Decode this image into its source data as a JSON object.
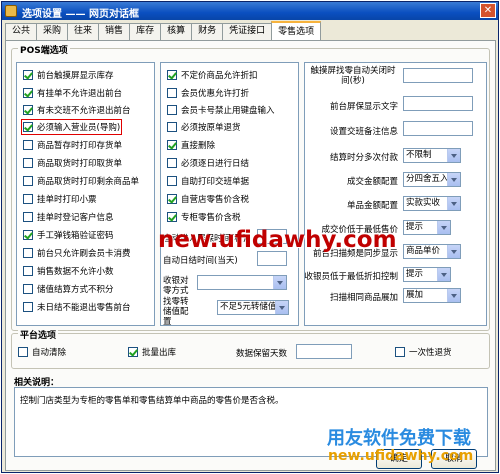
{
  "window": {
    "title": "选项设置 —— 网页对话框",
    "close_glyph": "✕"
  },
  "tabs": [
    "公共",
    "采购",
    "往来",
    "销售",
    "库存",
    "核算",
    "财务",
    "凭证接口",
    "零售选项"
  ],
  "pos_group": {
    "legend": "POS端选项",
    "left_items": [
      {
        "label": "前台触摸屏显示库存",
        "checked": true
      },
      {
        "label": "有挂单不允许退出前台",
        "checked": true
      },
      {
        "label": "有未交班不允许退出前台",
        "checked": true
      },
      {
        "label": "必须输入营业员(导购)",
        "checked": true
      },
      {
        "label": "商品暂存时打印存货单",
        "checked": false
      },
      {
        "label": "商品取货时打印取货单",
        "checked": false
      },
      {
        "label": "商品取货时打印剩余商品单",
        "checked": false
      },
      {
        "label": "挂单时打印小票",
        "checked": false
      },
      {
        "label": "挂单时登记客户信息",
        "checked": false
      },
      {
        "label": "手工弹钱箱验证密码",
        "checked": true
      },
      {
        "label": "前台只允许刷会员卡消费",
        "checked": false
      },
      {
        "label": "销售数据不允许小数",
        "checked": false
      },
      {
        "label": "储值结算方式不积分",
        "checked": false
      },
      {
        "label": "未日结不能退出零售前台",
        "checked": false
      }
    ],
    "mid_items": [
      {
        "label": "不定价商品允许折扣",
        "checked": true
      },
      {
        "label": "会员优惠允许打折",
        "checked": false
      },
      {
        "label": "会员卡号禁止用键盘输入",
        "checked": false
      },
      {
        "label": "必须按原单退货",
        "checked": false
      },
      {
        "label": "直接删除",
        "checked": true
      },
      {
        "label": "必须逐日进行日结",
        "checked": false
      },
      {
        "label": "自助打印交班单据",
        "checked": false
      },
      {
        "label": "自营店零售价含税",
        "checked": true
      },
      {
        "label": "专柜零售价含税",
        "checked": true
      }
    ],
    "mid_fields": {
      "screensaver_label": "自动进入屏保时间(秒)",
      "auto_daily_label": "自动日结时间(当天)",
      "rounding_label": "收银对零方式",
      "change_label": "找零转储值配置",
      "change_value": "不足5元转储值"
    },
    "right_fields": [
      {
        "label": "触摸屏找零自动关闭时间(秒)",
        "kind": "input",
        "value": ""
      },
      {
        "label": "前台屏保显示文字",
        "kind": "input",
        "value": ""
      },
      {
        "label": "设置交班备注信息",
        "kind": "input",
        "value": ""
      },
      {
        "label": "结算时分多次付款",
        "kind": "combo",
        "value": "不限制"
      },
      {
        "label": "成交金额配置",
        "kind": "combo",
        "value": "分四舍五入"
      },
      {
        "label": "单品金额配置",
        "kind": "combo",
        "value": "实款实收"
      },
      {
        "label": "成交价低于最低售价",
        "kind": "combo",
        "value": "提示"
      },
      {
        "label": "前台扫描频是同步显示",
        "kind": "combo",
        "value": "商品单价"
      },
      {
        "label": "收银员低于最低折扣控制",
        "kind": "combo",
        "value": "提示"
      },
      {
        "label": "扫描相同商品展加",
        "kind": "combo",
        "value": "展加"
      }
    ]
  },
  "platform_group": {
    "legend": "平台选项",
    "auto_clear": {
      "label": "自动清除",
      "checked": false
    },
    "batch_out": {
      "label": "批量出库",
      "checked": true
    },
    "retention_label": "数据保留天数",
    "one_time_return": {
      "label": "一次性退货",
      "checked": false
    }
  },
  "description": {
    "title": "相关说明：",
    "text": "控制门店类型为专柜的零售单和零售结算单中商品的零售价是否含税。"
  },
  "buttons": {
    "ok": "确定",
    "cancel": "取消"
  },
  "watermarks": {
    "main": "new.ufidawhy.com",
    "brand": "用友软件免费下载",
    "url": "new.ufidawhy.com"
  }
}
